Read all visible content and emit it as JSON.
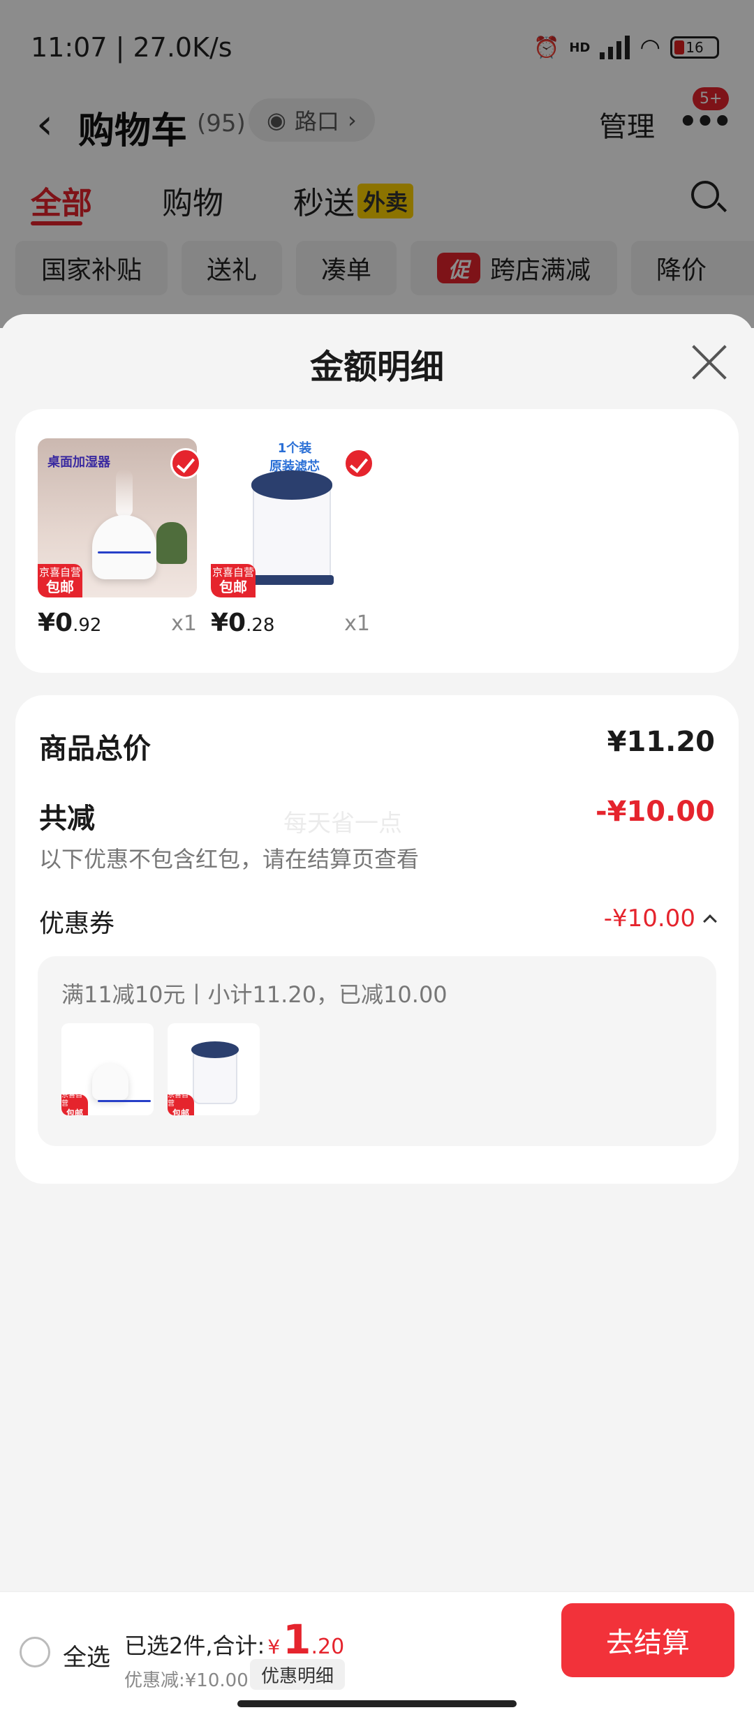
{
  "status_bar": {
    "time": "11:07 | 27.0K/s",
    "network": "HD",
    "battery": "16",
    "icons": [
      "alarm-icon",
      "signal-icon",
      "wifi-icon",
      "battery-icon"
    ]
  },
  "nav": {
    "back_icon": "chevron-left-icon",
    "title": "购物车",
    "count": "(95)",
    "location": "路口",
    "manage": "管理",
    "more_badge": "5+"
  },
  "tabs": [
    {
      "label": "全部",
      "active": true
    },
    {
      "label": "购物",
      "active": false
    },
    {
      "label": "秒送",
      "active": false,
      "tag": "外卖"
    }
  ],
  "chips": [
    {
      "label": "国家补贴"
    },
    {
      "label": "送礼"
    },
    {
      "label": "凑单"
    },
    {
      "label": "跨店满减",
      "promo_mark": "促"
    },
    {
      "label": "降价"
    }
  ],
  "sheet": {
    "title": "金额明细",
    "products": [
      {
        "image_text": "桌面加湿器",
        "ship_top": "京喜自营",
        "ship_bottom": "包邮",
        "price_int": "¥0",
        "price_dec": ".92",
        "qty": "x1"
      },
      {
        "image_text_1": "1个装",
        "image_text_2": "原装滤芯",
        "ship_top": "京喜自营",
        "ship_bottom": "包邮",
        "price_int": "¥0",
        "price_dec": ".28",
        "qty": "x1"
      }
    ],
    "summary": {
      "total_label": "商品总价",
      "total_value": "¥11.20",
      "reduce_label": "共减",
      "reduce_value": "-¥10.00",
      "watermark": "每天省一点",
      "note": "以下优惠不包含红包，请在结算页查看",
      "coupon_label": "优惠券",
      "coupon_value": "-¥10.00",
      "coupon_rule": "满11减10元丨小计11.20，已减10.00"
    }
  },
  "bottom_bar": {
    "select_all": "全选",
    "selected_text": "已选2件,合计:",
    "currency": "¥",
    "total_int": "1",
    "total_dec": ".20",
    "discount_text": "优惠减:¥10.00",
    "detail_button": "优惠明细",
    "checkout_button": "去结算"
  },
  "colors": {
    "accent_red": "#e5242d",
    "checkout_red": "#f2323a",
    "tag_yellow": "#ffd100"
  }
}
